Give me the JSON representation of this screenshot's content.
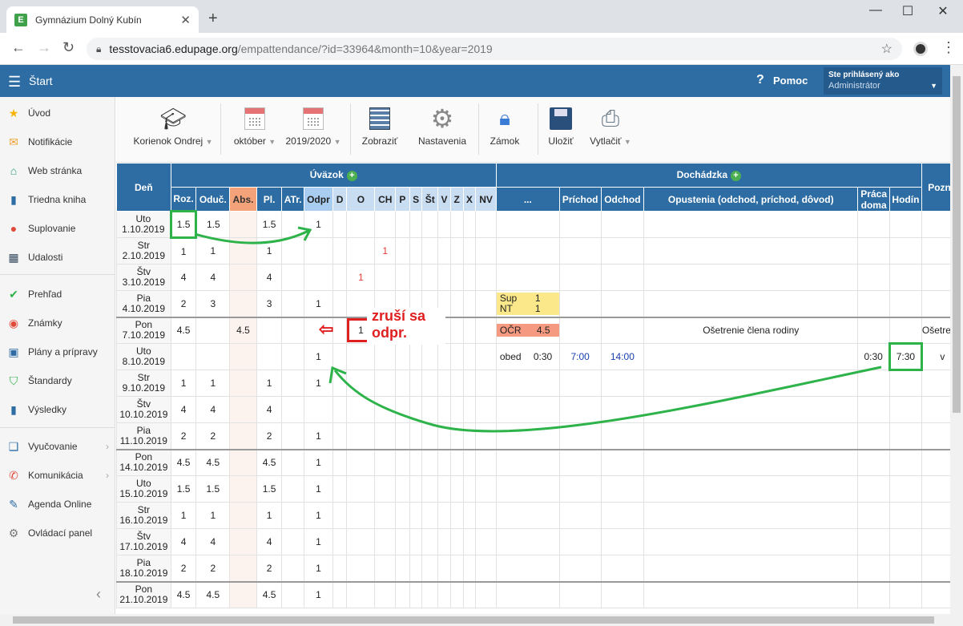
{
  "browser": {
    "tab_title": "Gymnázium Dolný Kubín",
    "favicon": "E",
    "url_host": "tesstovacia6.edupage.org",
    "url_path": "/empattendance/?id=33964&month=10&year=2019"
  },
  "header": {
    "start": "Štart",
    "help": "Pomoc",
    "user_label": "Ste prihlásený ako",
    "user_name": "Administrátor"
  },
  "sidebar": {
    "items": [
      {
        "label": "Úvod",
        "icon": "star-icon"
      },
      {
        "label": "Notifikácie",
        "icon": "envelope-icon"
      },
      {
        "label": "Web stránka",
        "icon": "home-icon"
      },
      {
        "label": "Triedna kniha",
        "icon": "book-icon"
      },
      {
        "label": "Suplovanie",
        "icon": "person-icon"
      },
      {
        "label": "Udalosti",
        "icon": "calendar-icon"
      },
      {
        "label": "Prehľad",
        "icon": "check-icon"
      },
      {
        "label": "Známky",
        "icon": "grades-icon"
      },
      {
        "label": "Plány a prípravy",
        "icon": "briefcase-icon"
      },
      {
        "label": "Štandardy",
        "icon": "shield-icon"
      },
      {
        "label": "Výsledky",
        "icon": "bar-chart-icon"
      },
      {
        "label": "Vyučovanie",
        "icon": "open-book-icon"
      },
      {
        "label": "Komunikácia",
        "icon": "chat-icon"
      },
      {
        "label": "Agenda Online",
        "icon": "pen-icon"
      },
      {
        "label": "Ovládací panel",
        "icon": "gear-icon"
      }
    ]
  },
  "toolbar": {
    "teacher": "Korienok Ondrej",
    "month": "október",
    "year": "2019/2020",
    "show": "Zobraziť",
    "settings": "Nastavenia",
    "lock": "Zámok",
    "save": "Uložiť",
    "print": "Vytlačiť"
  },
  "table": {
    "group_uvazok": "Úväzok",
    "group_dochadzka": "Dochádzka",
    "col_day": "Deň",
    "col_poznamka": "Pozná",
    "columns": [
      "Roz.",
      "Oduč.",
      "Abs.",
      "Pl.",
      "ATr.",
      "Odpr",
      "D",
      "O",
      "CH",
      "P",
      "S",
      "Št",
      "V",
      "Z",
      "X",
      "NV",
      "...",
      "Príchod",
      "Odchod",
      "Opustenia (odchod, príchod, dôvod)",
      "Práca doma",
      "Hodín"
    ],
    "rows": [
      {
        "day": "Uto",
        "date": "1.10.2019",
        "roz": "1.5",
        "oduc": "1.5",
        "abs": "",
        "pl": "1.5",
        "odpr": "1"
      },
      {
        "day": "Str",
        "date": "2.10.2019",
        "roz": "1",
        "oduc": "1",
        "abs": "",
        "pl": "1",
        "odpr": "",
        "ch": "1"
      },
      {
        "day": "Štv",
        "date": "3.10.2019",
        "roz": "4",
        "oduc": "4",
        "abs": "",
        "pl": "4",
        "odpr": "",
        "o": "1"
      },
      {
        "day": "Pia",
        "date": "4.10.2019",
        "roz": "2",
        "oduc": "3",
        "abs": "",
        "pl": "3",
        "odpr": "1",
        "sup1_label": "Sup",
        "sup1_val": "1",
        "sup2_label": "NT",
        "sup2_val": "1"
      },
      {
        "day": "Pon",
        "date": "7.10.2019",
        "roz": "4.5",
        "oduc": "",
        "abs": "4.5",
        "pl": "",
        "odpr": "",
        "o": "1",
        "ocr_label": "OČR",
        "ocr_val": "4.5",
        "opustenia": "Ošetrenie člena rodiny",
        "pozn": "Ošetre ro"
      },
      {
        "day": "Uto",
        "date": "8.10.2019",
        "roz": "",
        "oduc": "",
        "abs": "",
        "pl": "",
        "odpr": "1",
        "dots": "obed",
        "dots_val": "0:30",
        "prichod": "7:00",
        "odchod": "14:00",
        "praca": "0:30",
        "hodin": "7:30",
        "pozn": "v"
      },
      {
        "day": "Str",
        "date": "9.10.2019",
        "roz": "1",
        "oduc": "1",
        "abs": "",
        "pl": "1",
        "odpr": "1"
      },
      {
        "day": "Štv",
        "date": "10.10.2019",
        "roz": "4",
        "oduc": "4",
        "abs": "",
        "pl": "4",
        "odpr": ""
      },
      {
        "day": "Pia",
        "date": "11.10.2019",
        "roz": "2",
        "oduc": "2",
        "abs": "",
        "pl": "2",
        "odpr": "1"
      },
      {
        "day": "Pon",
        "date": "14.10.2019",
        "roz": "4.5",
        "oduc": "4.5",
        "abs": "",
        "pl": "4.5",
        "odpr": "1"
      },
      {
        "day": "Uto",
        "date": "15.10.2019",
        "roz": "1.5",
        "oduc": "1.5",
        "abs": "",
        "pl": "1.5",
        "odpr": "1"
      },
      {
        "day": "Str",
        "date": "16.10.2019",
        "roz": "1",
        "oduc": "1",
        "abs": "",
        "pl": "1",
        "odpr": "1"
      },
      {
        "day": "Štv",
        "date": "17.10.2019",
        "roz": "4",
        "oduc": "4",
        "abs": "",
        "pl": "4",
        "odpr": "1"
      },
      {
        "day": "Pia",
        "date": "18.10.2019",
        "roz": "2",
        "oduc": "2",
        "abs": "",
        "pl": "2",
        "odpr": "1"
      },
      {
        "day": "Pon",
        "date": "21.10.2019",
        "roz": "4.5",
        "oduc": "4.5",
        "abs": "",
        "pl": "4.5",
        "odpr": "1"
      }
    ]
  },
  "annotation": {
    "line1": "zruší sa",
    "line2": "odpr."
  },
  "colors": {
    "header_blue": "#2e6da4",
    "abs_orange": "#f4a27a",
    "green_annotation": "#2db34a",
    "red_annotation": "#e02020"
  }
}
